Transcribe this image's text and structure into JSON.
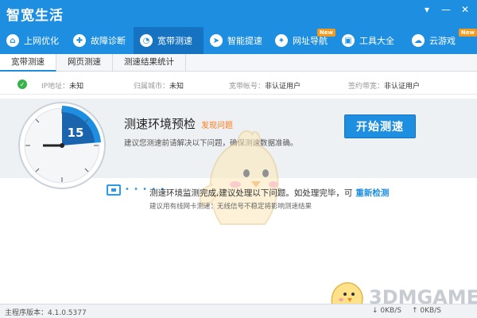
{
  "app": {
    "title": "智宽生活"
  },
  "window_controls": {
    "menu": "▾",
    "minimize": "—",
    "close": "✕"
  },
  "nav": [
    {
      "label": "上网优化",
      "icon": "home-icon",
      "glyph": "⌂",
      "badge": ""
    },
    {
      "label": "故障诊断",
      "icon": "shield-icon",
      "glyph": "✚",
      "badge": ""
    },
    {
      "label": "宽带测速",
      "icon": "speedometer-icon",
      "glyph": "◔",
      "badge": "",
      "active": true
    },
    {
      "label": "智能提速",
      "icon": "rocket-icon",
      "glyph": "➤",
      "badge": ""
    },
    {
      "label": "网址导航",
      "icon": "compass-icon",
      "glyph": "✦",
      "badge": "New"
    },
    {
      "label": "工具大全",
      "icon": "briefcase-icon",
      "glyph": "▣",
      "badge": ""
    },
    {
      "label": "云游戏",
      "icon": "cloud-icon",
      "glyph": "☁",
      "badge": "New"
    }
  ],
  "subtabs": [
    "宽带测速",
    "网页测速",
    "测速结果统计"
  ],
  "info": {
    "ip_label": "IP地址：",
    "ip_value": "未知",
    "city_label": "归属城市：",
    "city_value": "未知",
    "account_label": "宽带帐号：",
    "account_value": "非认证用户",
    "bandwidth_label": "签约带宽：",
    "bandwidth_value": "非认证用户"
  },
  "main": {
    "headline": "测速环境预检",
    "found": "发现问题",
    "tip": "建议您测速前请解决以下问题，确保测速数据准确。",
    "start_button": "开始测速",
    "clock_value": "15"
  },
  "results": {
    "dots": "• • • • •",
    "line": "测速环境监测完成,建议处理以下问题。如处理完毕，可",
    "recheck": "重新检测",
    "hint": "建议用有线网卡测速：无线信号不稳定将影响测速结果"
  },
  "status": {
    "version_label": "主程序版本：",
    "version_value": "4.1.0.5377",
    "down": "↓ 0KB/S",
    "up": "↑ 0KB/S"
  },
  "watermark": "3DMGAME",
  "colors": {
    "brand": "#1e8fe0",
    "accent": "#ff7a1a",
    "ok": "#37b24d"
  }
}
